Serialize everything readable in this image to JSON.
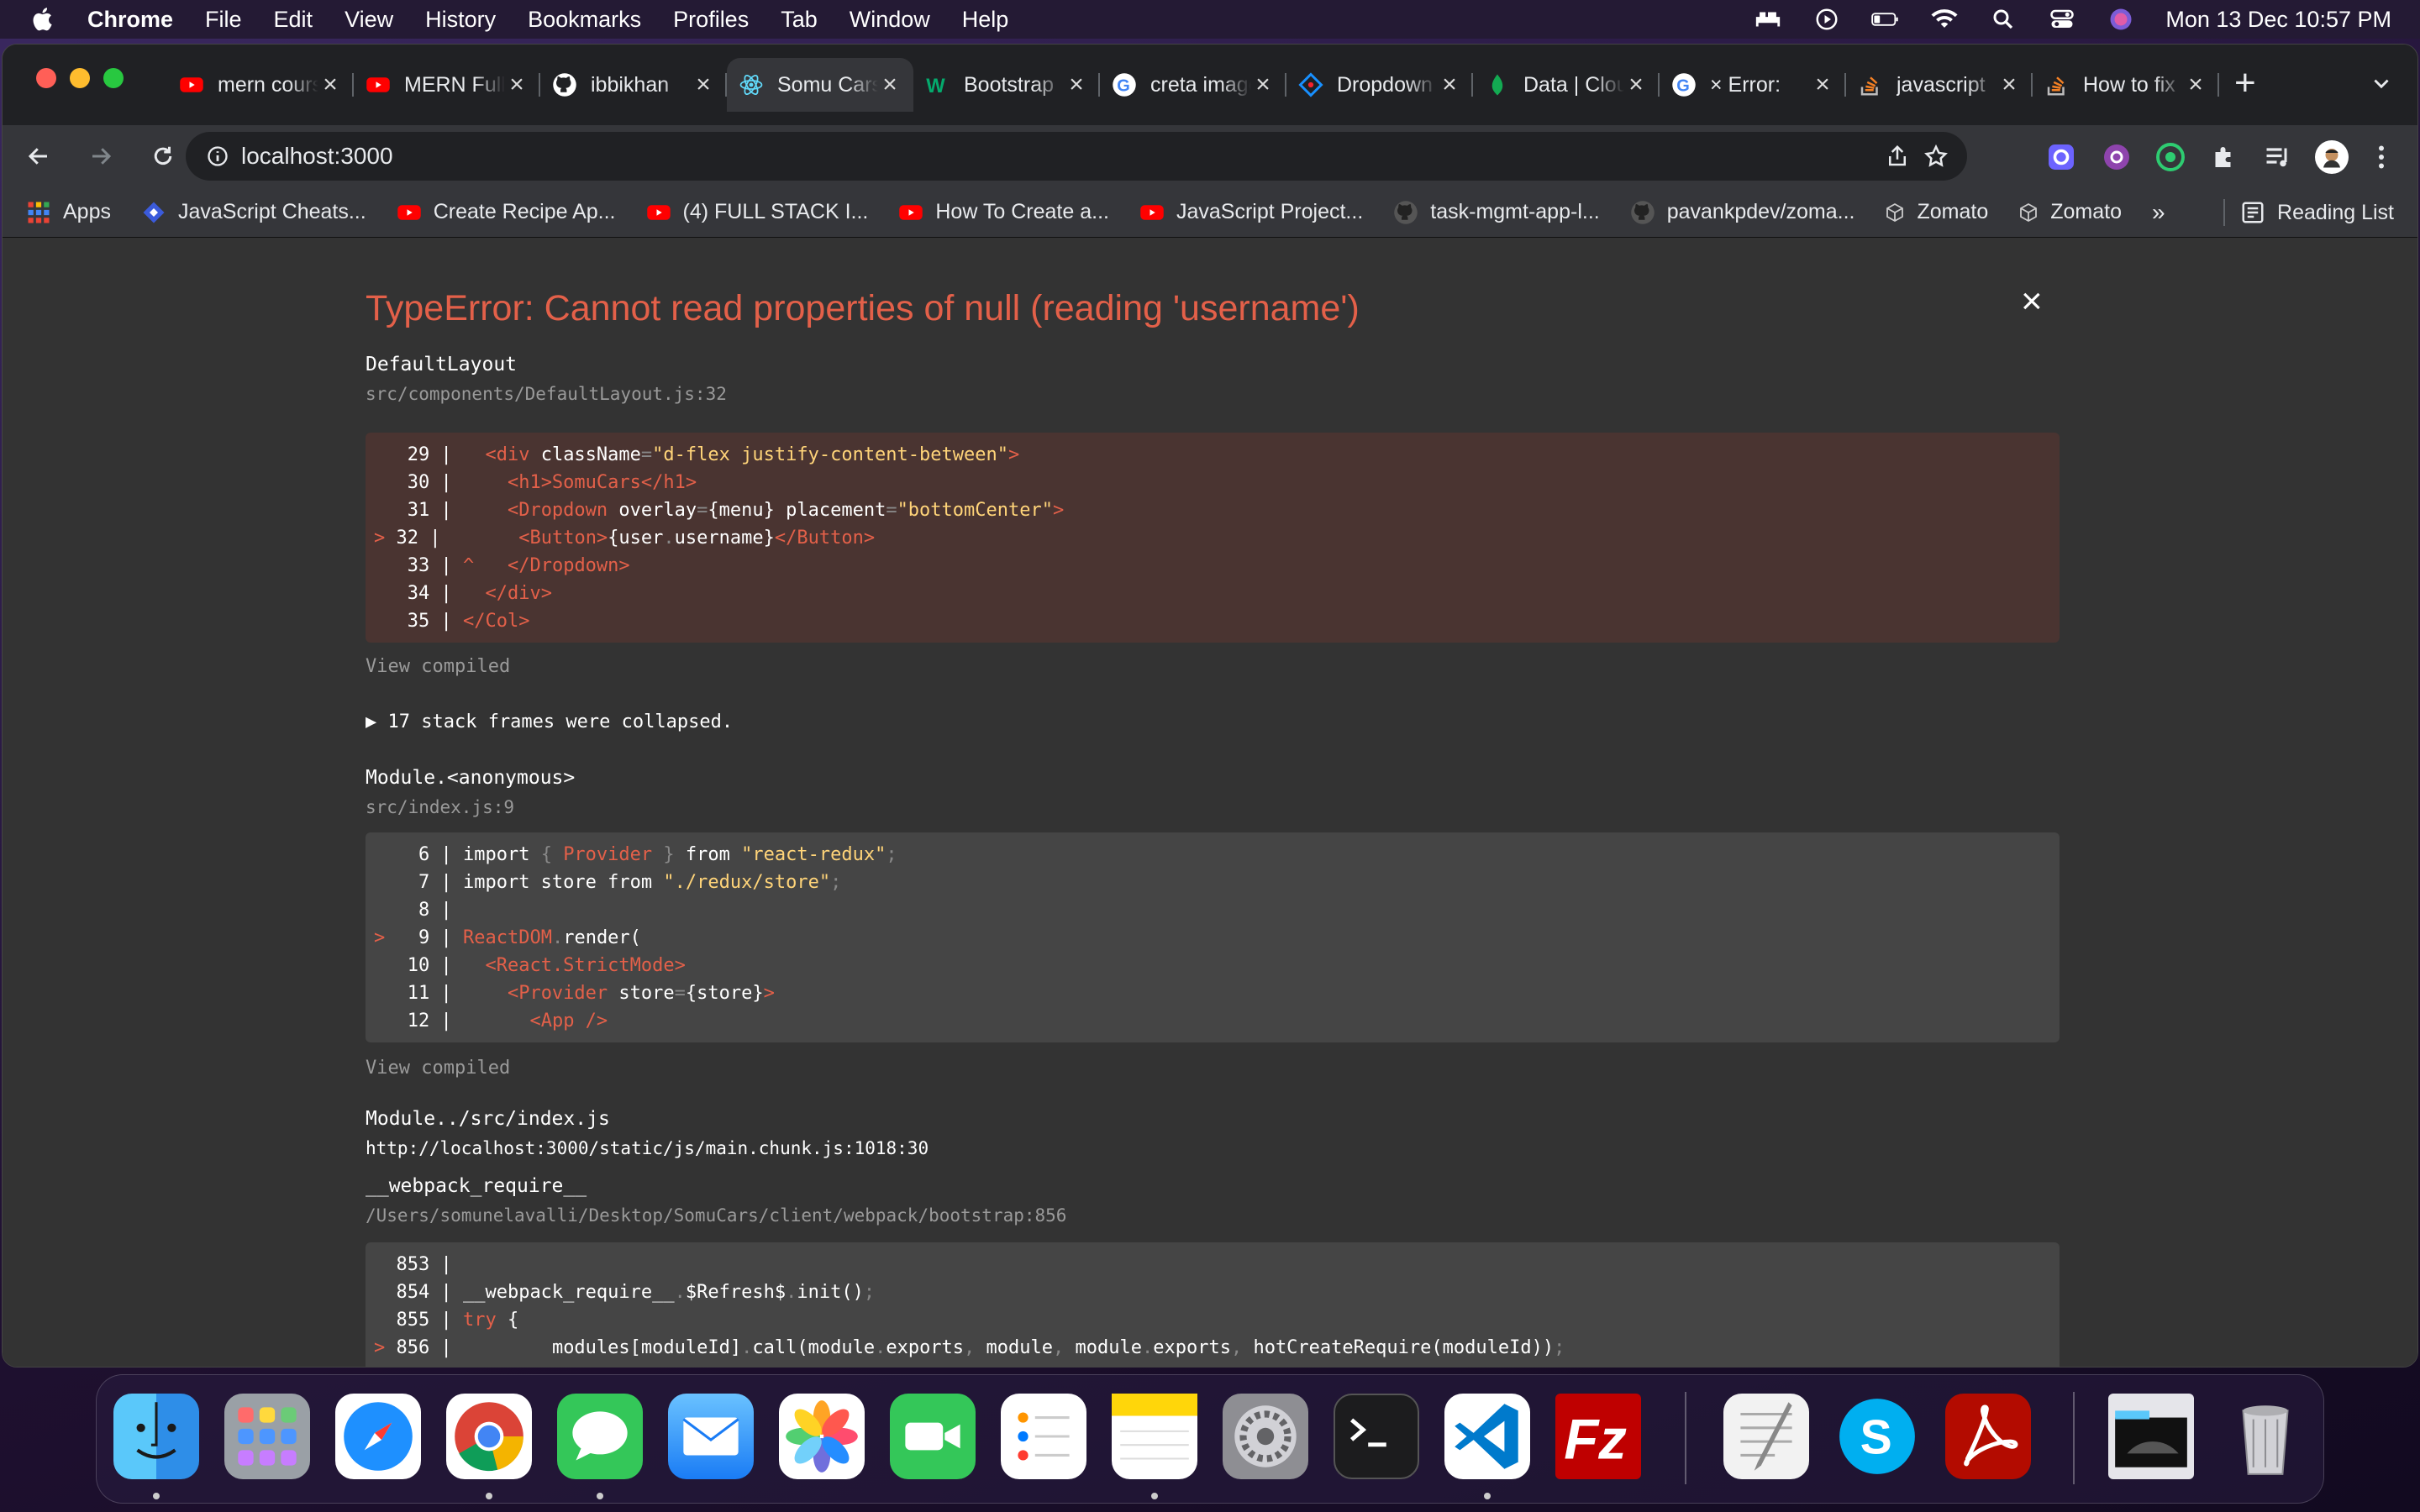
{
  "menubar": {
    "app": "Chrome",
    "items": [
      "File",
      "Edit",
      "View",
      "History",
      "Bookmarks",
      "Profiles",
      "Tab",
      "Window",
      "Help"
    ],
    "clock": "Mon 13 Dec  10:57 PM"
  },
  "tabs": [
    {
      "title": "mern course",
      "icon": "youtube-icon",
      "active": false
    },
    {
      "title": "MERN Full",
      "icon": "youtube-icon",
      "active": false
    },
    {
      "title": "ibbikhan",
      "icon": "github-icon",
      "active": false
    },
    {
      "title": "Somu Cars",
      "icon": "react-icon",
      "active": true
    },
    {
      "title": "Bootstrap",
      "icon": "w3schools-icon",
      "active": false
    },
    {
      "title": "creta images",
      "icon": "google-icon",
      "active": false
    },
    {
      "title": "Dropdown",
      "icon": "antd-icon",
      "active": false
    },
    {
      "title": "Data | Cloud",
      "icon": "mongodb-icon",
      "active": false
    },
    {
      "title": "× Error:",
      "icon": "google-icon",
      "active": false
    },
    {
      "title": "javascript",
      "icon": "stackoverflow-icon",
      "active": false
    },
    {
      "title": "How to fix",
      "icon": "stackoverflow-icon",
      "active": false
    }
  ],
  "toolbar": {
    "url": "localhost:3000"
  },
  "bookmarks": [
    {
      "label": "Apps",
      "icon": "apps-grid-icon"
    },
    {
      "label": "JavaScript Cheats...",
      "icon": "blue-diamond-icon"
    },
    {
      "label": "Create Recipe Ap...",
      "icon": "youtube-icon"
    },
    {
      "label": "(4) FULL STACK I...",
      "icon": "youtube-icon"
    },
    {
      "label": "How To Create a...",
      "icon": "youtube-icon"
    },
    {
      "label": "JavaScript Project...",
      "icon": "youtube-icon"
    },
    {
      "label": "task-mgmt-app-l...",
      "icon": "github-icon"
    },
    {
      "label": "pavankpdev/zoma...",
      "icon": "github-icon"
    },
    {
      "label": "Zomato",
      "icon": "cube-icon"
    },
    {
      "label": "Zomato",
      "icon": "cube-icon"
    }
  ],
  "bookmarks_more": "»",
  "reading_list": "Reading List",
  "overlay": {
    "title": "TypeError: Cannot read properties of null (reading 'username')",
    "close": "×",
    "frames": [
      {
        "name": "DefaultLayout",
        "location": "src/components/DefaultLayout.js:32",
        "view_compiled": "View compiled"
      },
      {
        "name": "Module.<anonymous>",
        "location": "src/index.js:9",
        "view_compiled": "View compiled"
      },
      {
        "name": "Module../src/index.js",
        "location": "http://localhost:3000/static/js/main.chunk.js:1018:30"
      },
      {
        "name": "__webpack_require__",
        "location": "/Users/somunelavalli/Desktop/SomuCars/client/webpack/bootstrap:856"
      }
    ],
    "collapsed": "▶ 17 stack frames were collapsed."
  },
  "dock": [
    "finder-icon",
    "launchpad-icon",
    "safari-icon",
    "chrome-icon",
    "messages-icon",
    "mail-icon",
    "photos-icon",
    "facetime-icon",
    "reminders-icon",
    "notes-icon",
    "system-preferences-icon",
    "terminal-icon",
    "vscode-icon",
    "filezilla-icon",
    "textedit-icon",
    "skype-icon",
    "acrobat-icon",
    "downloads-stack-icon",
    "trash-icon"
  ],
  "colors": {
    "error_red": "#e36049",
    "overlay_bg": "#333333",
    "code_bg": "#454545",
    "code_err_bg": "#4a3431"
  }
}
